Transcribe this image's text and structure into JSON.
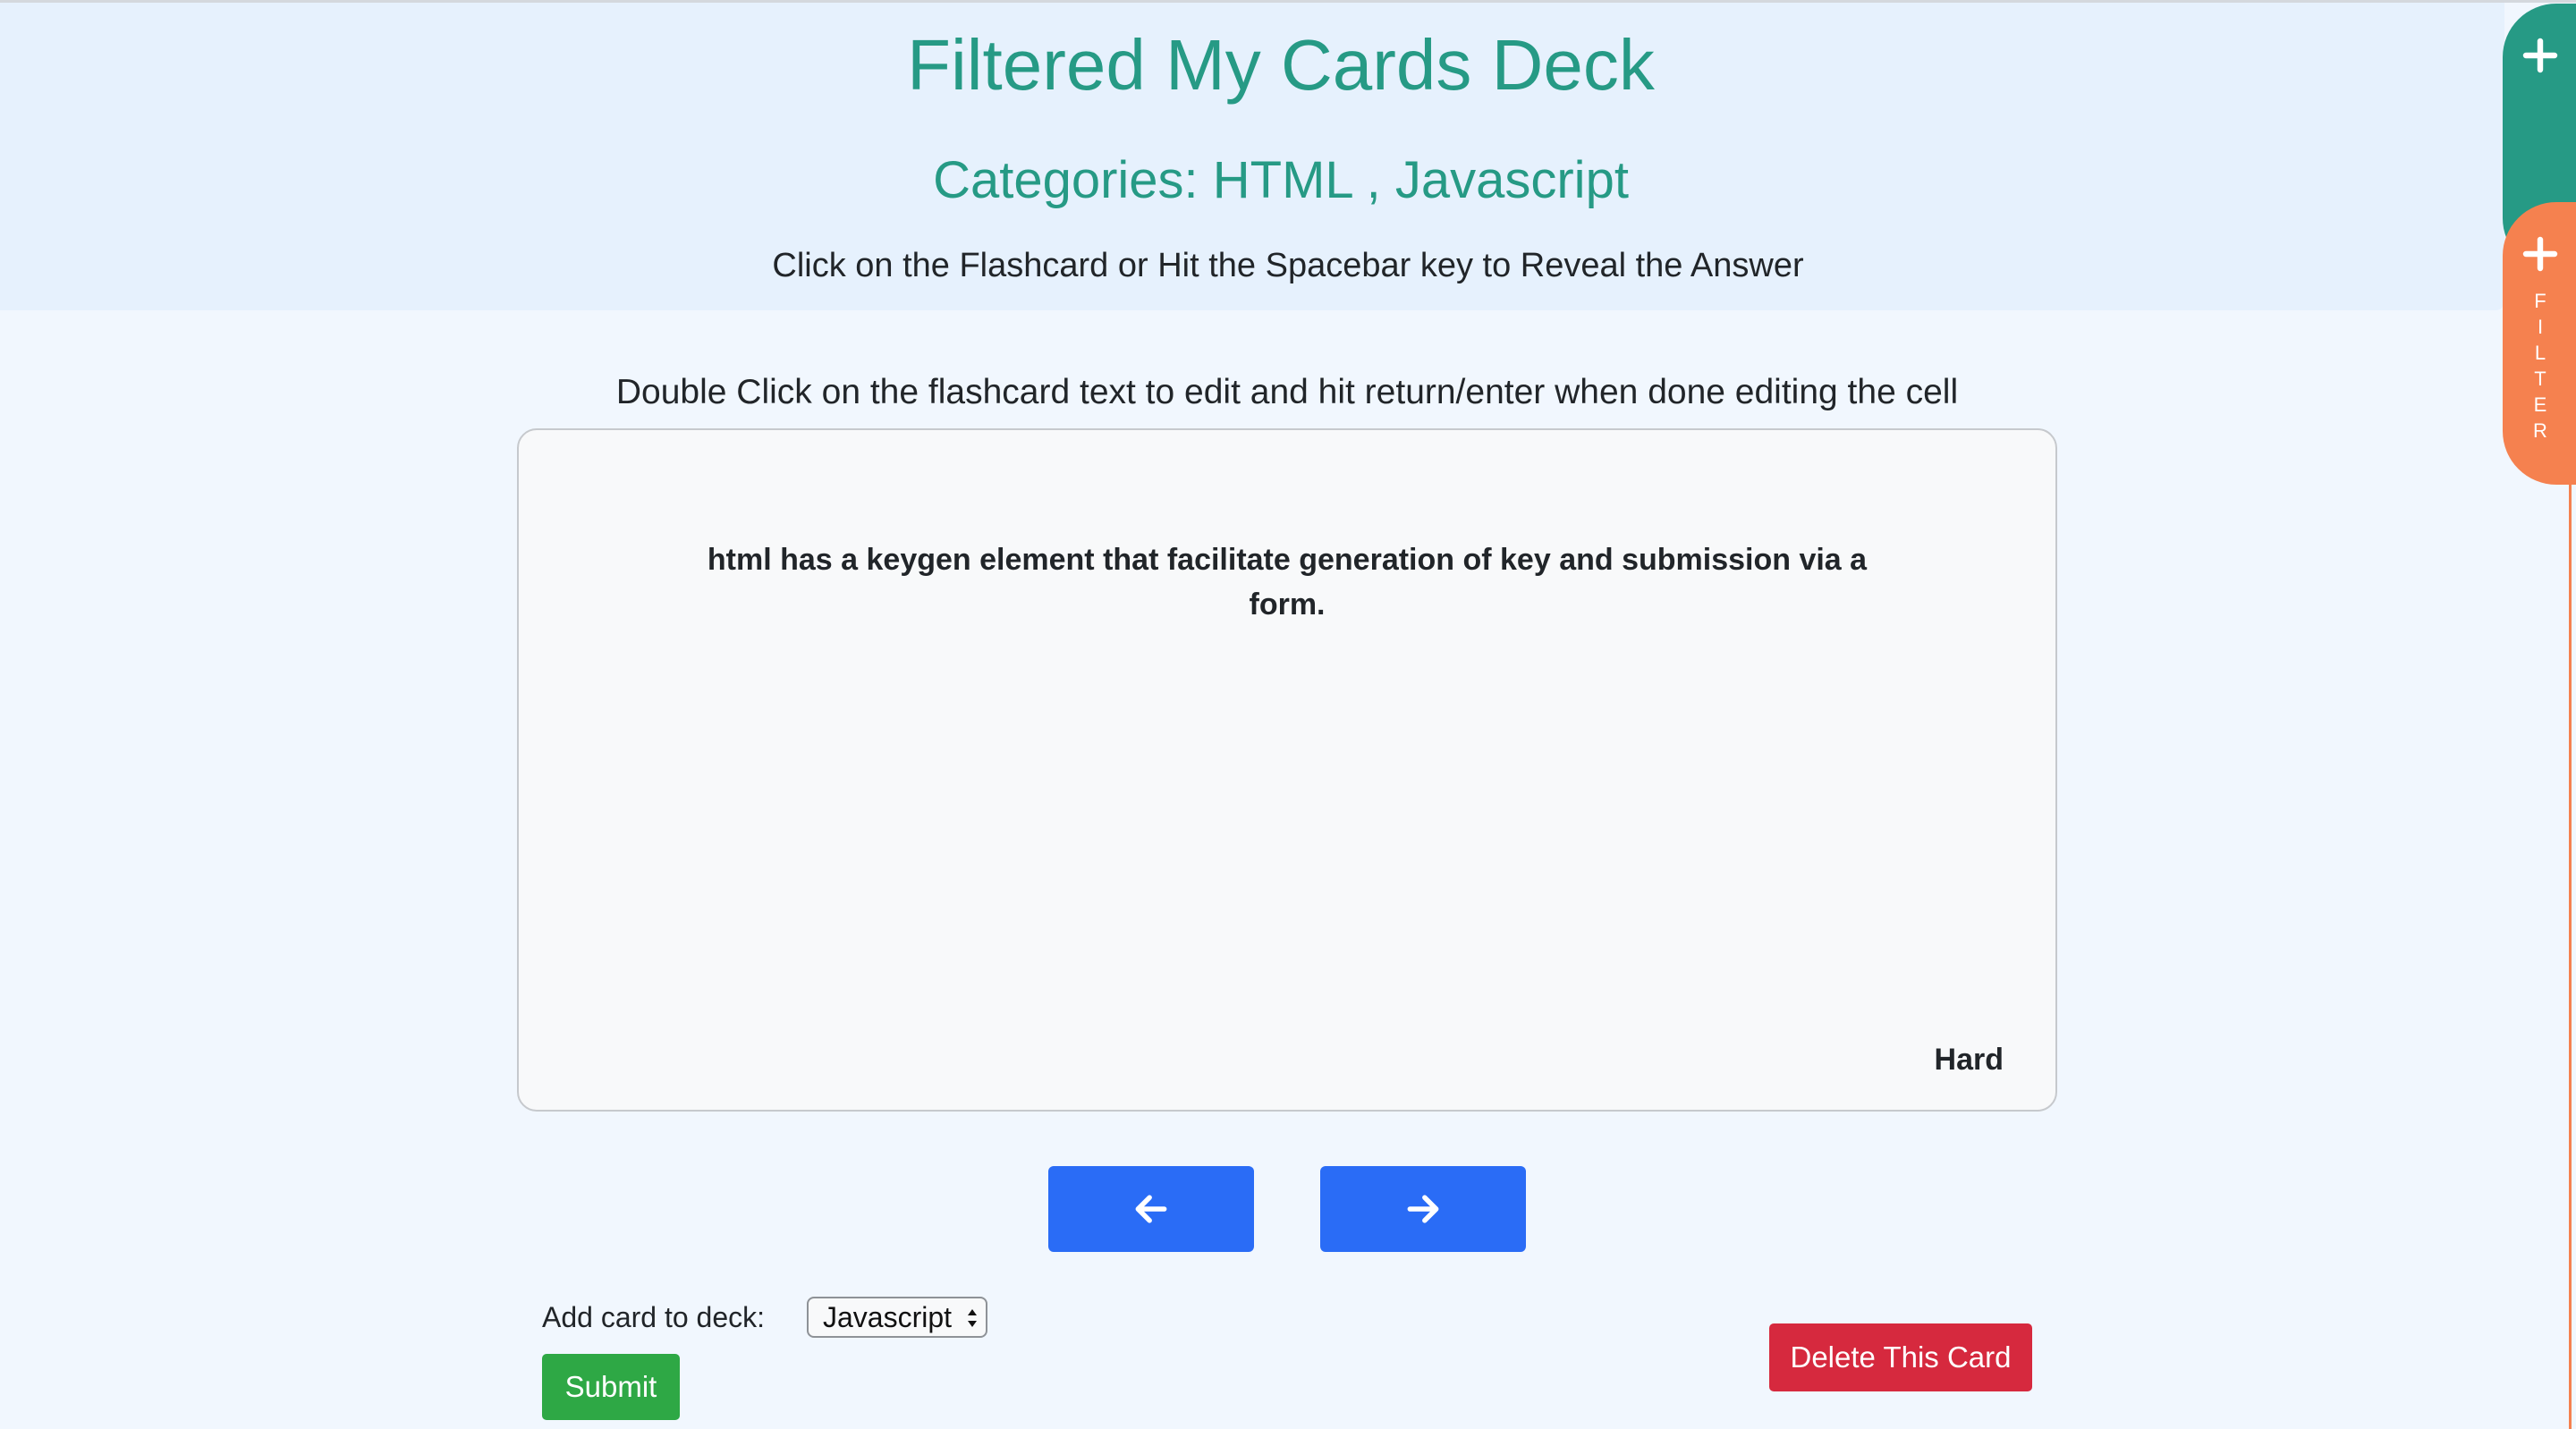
{
  "header": {
    "title": "Filtered My Cards Deck",
    "subtitle": "Categories: HTML , Javascript",
    "instruction": "Click on the Flashcard or Hit the Spacebar key to Reveal the Answer"
  },
  "edit_hint": "Double Click on the flashcard text to edit and hit return/enter when done editing the cell",
  "flashcard": {
    "text": "html has a keygen element that facilitate generation of key and submission via a form.",
    "difficulty": "Hard"
  },
  "navigation": {
    "prev_icon": "arrow-left-icon",
    "next_icon": "arrow-right-icon"
  },
  "deck_form": {
    "label": "Add card to deck:",
    "selected_deck": "Javascript",
    "submit_label": "Submit"
  },
  "delete_label": "Delete This Card",
  "side_tabs": {
    "add_icon": "plus-icon",
    "filter_letters": [
      "F",
      "I",
      "L",
      "T",
      "E",
      "R"
    ]
  },
  "colors": {
    "teal": "#269a85",
    "orange": "#f5814f",
    "blue": "#2a6cf6",
    "green": "#2ea845",
    "red": "#d6293e",
    "header_bg": "#e6f1fd",
    "page_bg": "#f1f7fe"
  }
}
